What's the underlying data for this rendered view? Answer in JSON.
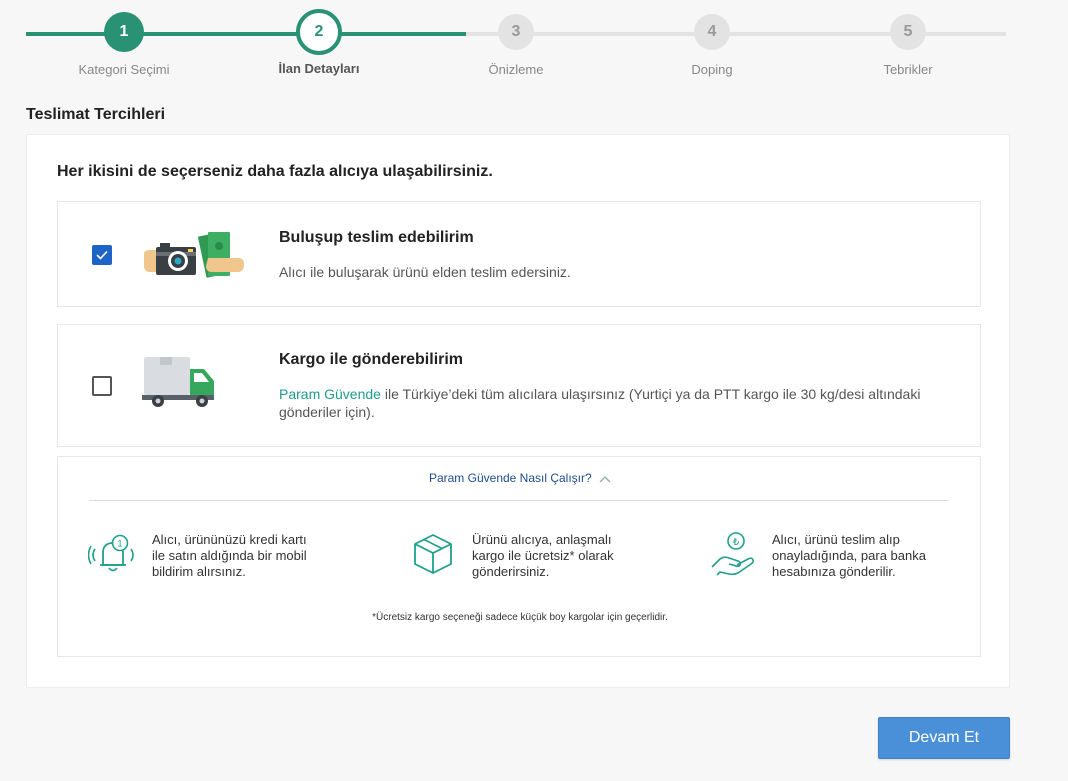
{
  "colors": {
    "accent": "#2a9274",
    "primary_button": "#4a90d9",
    "link": "#1e9c8c",
    "checkbox": "#1e64c8"
  },
  "stepper": {
    "steps": [
      {
        "number": "1",
        "label": "Kategori Seçimi",
        "state": "done"
      },
      {
        "number": "2",
        "label": "İlan Detayları",
        "state": "active"
      },
      {
        "number": "3",
        "label": "Önizleme",
        "state": "todo"
      },
      {
        "number": "4",
        "label": "Doping",
        "state": "todo"
      },
      {
        "number": "5",
        "label": "Tebrikler",
        "state": "todo"
      }
    ]
  },
  "section_title": "Teslimat Tercihleri",
  "card": {
    "heading": "Her ikisini de seçerseniz daha fazla alıcıya ulaşabilirsiniz.",
    "options": [
      {
        "title": "Buluşup teslim edebilirim",
        "description": "Alıcı ile buluşarak ürünü elden teslim edersiniz.",
        "checked": true,
        "icon": "hand-exchange-illustration"
      },
      {
        "title": "Kargo ile gönderebilirim",
        "link_text": "Param Güvende",
        "description_rest": " ile Türkiye’deki tüm alıcılara ulaşırsınız (Yurtiçi ya da PTT kargo ile 30 kg/desi altındaki gönderiler için).",
        "checked": false,
        "icon": "delivery-truck-illustration"
      }
    ]
  },
  "info": {
    "toggle_label": "Param Güvende Nasıl Çalışır?",
    "items": [
      {
        "icon": "notification-bell-icon",
        "text": "Alıcı, ürününüzü kredi kartı\nile satın aldığında bir mobil\nbildirim alırsınız."
      },
      {
        "icon": "package-box-icon",
        "text": "Ürünü alıcıya, anlaşmalı\nkargo ile ücretsiz* olarak\ngönderirsiniz."
      },
      {
        "icon": "hand-lira-coin-icon",
        "text": "Alıcı, ürünü teslim alıp\nonayladığında, para banka\nhesabınıza gönderilir."
      }
    ],
    "note": "*Ücretsiz kargo seçeneği sadece küçük boy kargolar için geçerlidir."
  },
  "continue_button": "Devam Et"
}
